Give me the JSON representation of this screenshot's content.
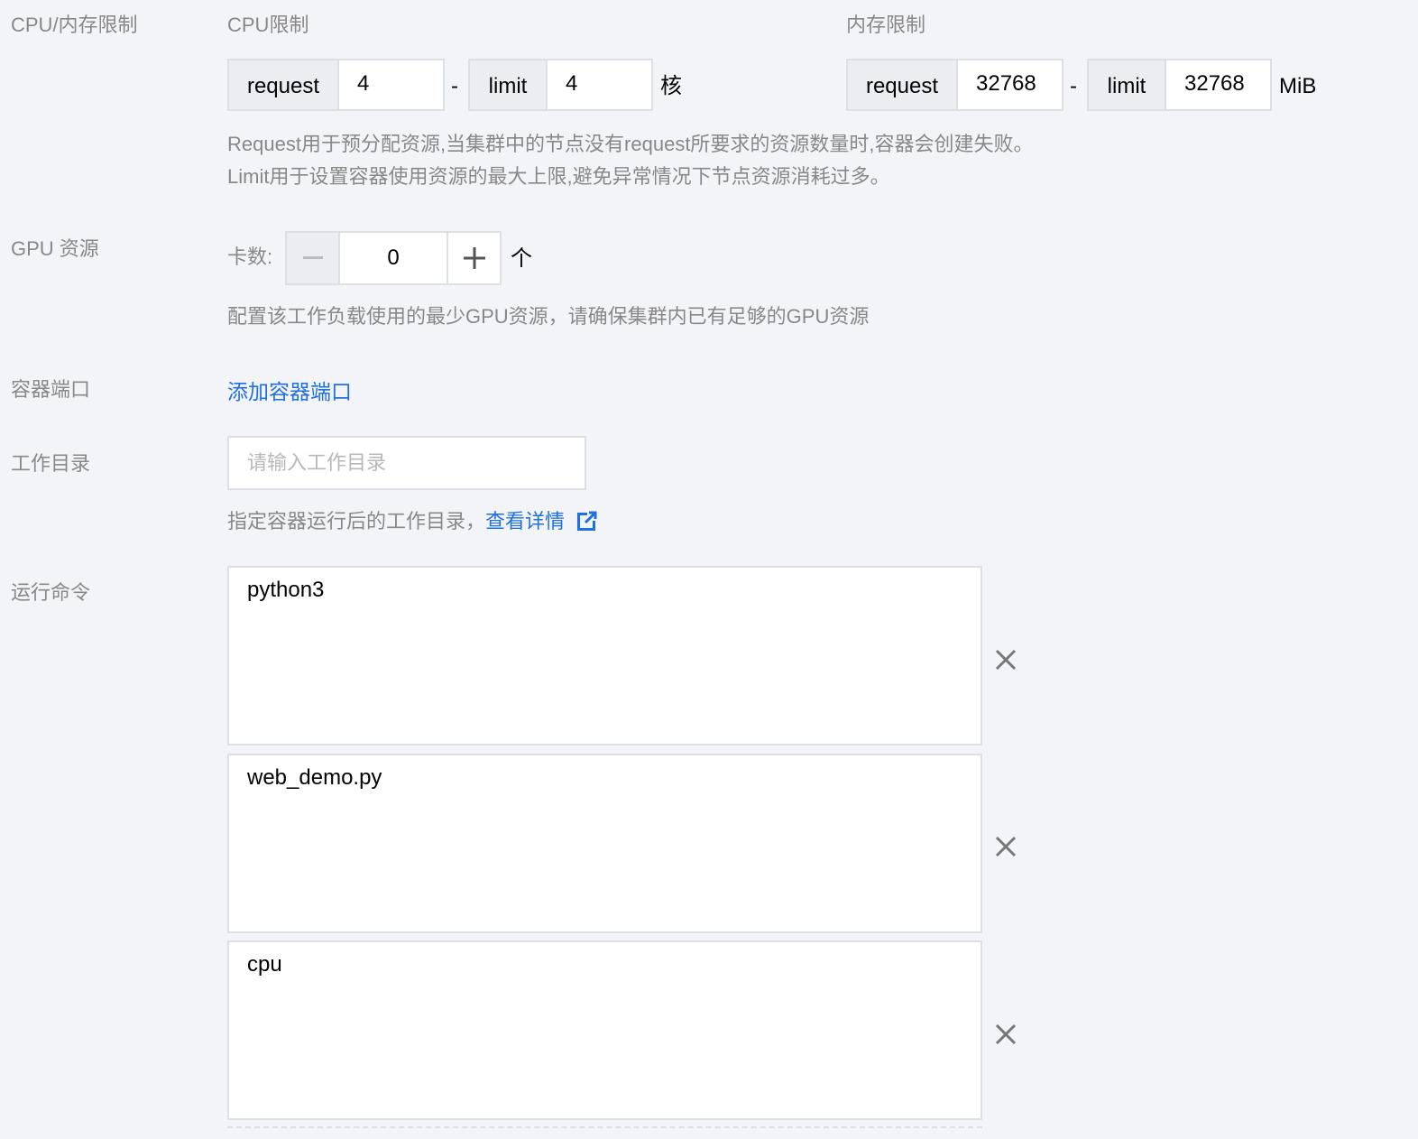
{
  "resources": {
    "label": "CPU/内存限制",
    "cpu": {
      "title": "CPU限制",
      "request_label": "request",
      "request_value": "4",
      "limit_label": "limit",
      "limit_value": "4",
      "separator": "-",
      "unit": "核"
    },
    "memory": {
      "title": "内存限制",
      "request_label": "request",
      "request_value": "32768",
      "limit_label": "limit",
      "limit_value": "32768",
      "separator": "-",
      "unit": "MiB"
    },
    "help_line1": "Request用于预分配资源,当集群中的节点没有request所要求的资源数量时,容器会创建失败。",
    "help_line2": "Limit用于设置容器使用资源的最大上限,避免异常情况下节点资源消耗过多。"
  },
  "gpu": {
    "label": "GPU 资源",
    "count_label": "卡数:",
    "count_value": "0",
    "unit": "个",
    "help": "配置该工作负载使用的最少GPU资源，请确保集群内已有足够的GPU资源"
  },
  "ports": {
    "label": "容器端口",
    "add_link": "添加容器端口"
  },
  "workdir": {
    "label": "工作目录",
    "placeholder": "请输入工作目录",
    "value": "",
    "help": "指定容器运行后的工作目录，",
    "help_link": "查看详情"
  },
  "command": {
    "label": "运行命令",
    "items": [
      {
        "value": "python3"
      },
      {
        "value": "web_demo.py"
      },
      {
        "value": "cpu"
      }
    ]
  }
}
